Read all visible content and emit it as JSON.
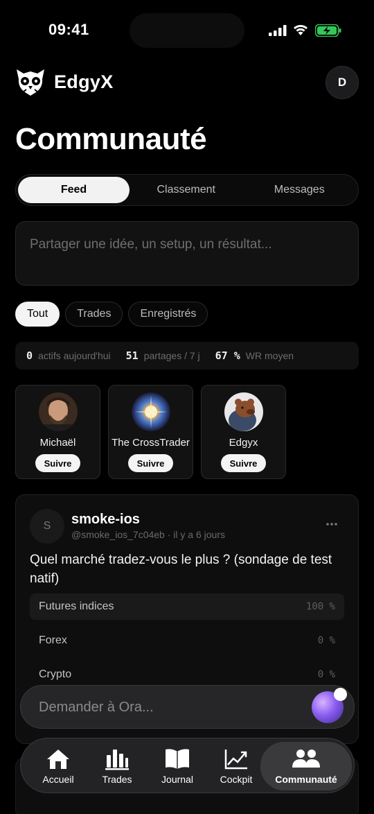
{
  "status": {
    "time": "09:41"
  },
  "brand": {
    "name": "EdgyX"
  },
  "profile": {
    "initial": "D"
  },
  "page": {
    "title": "Communauté"
  },
  "tabs": [
    {
      "label": "Feed",
      "active": true
    },
    {
      "label": "Classement",
      "active": false
    },
    {
      "label": "Messages",
      "active": false
    }
  ],
  "composer": {
    "placeholder": "Partager une idée, un setup, un résultat..."
  },
  "filters": [
    {
      "label": "Tout",
      "active": true
    },
    {
      "label": "Trades",
      "active": false
    },
    {
      "label": "Enregistrés",
      "active": false
    }
  ],
  "stats": [
    {
      "value": "0",
      "label": "actifs aujourd'hui"
    },
    {
      "value": "51",
      "label": "partages / 7 j"
    },
    {
      "value": "67 %",
      "label": "WR moyen"
    }
  ],
  "suggestions": [
    {
      "name": "Michaël",
      "follow": "Suivre"
    },
    {
      "name": "The CrossTrader",
      "follow": "Suivre"
    },
    {
      "name": "Edgyx",
      "follow": "Suivre"
    }
  ],
  "post": {
    "avatar_initial": "S",
    "author": "smoke-ios",
    "meta": "@smoke_ios_7c04eb · il y a 6 jours",
    "text": "Quel marché tradez-vous le plus ? (sondage de test natif)",
    "poll": [
      {
        "label": "Futures indices",
        "pct": "100 %",
        "value": 100
      },
      {
        "label": "Forex",
        "pct": "0 %",
        "value": 0
      },
      {
        "label": "Crypto",
        "pct": "0 %",
        "value": 0
      }
    ]
  },
  "assistant": {
    "placeholder": "Demander à Ora..."
  },
  "nav": [
    {
      "label": "Accueil",
      "icon": "home-icon"
    },
    {
      "label": "Trades",
      "icon": "bar-chart-icon"
    },
    {
      "label": "Journal",
      "icon": "book-icon"
    },
    {
      "label": "Cockpit",
      "icon": "line-chart-icon"
    },
    {
      "label": "Communauté",
      "icon": "users-icon",
      "active": true
    }
  ],
  "colors": {
    "background": "#000000",
    "surface": "#121212",
    "accent": "#f4f4f4",
    "battery": "#34c759",
    "orb": "#8a5cf0"
  }
}
